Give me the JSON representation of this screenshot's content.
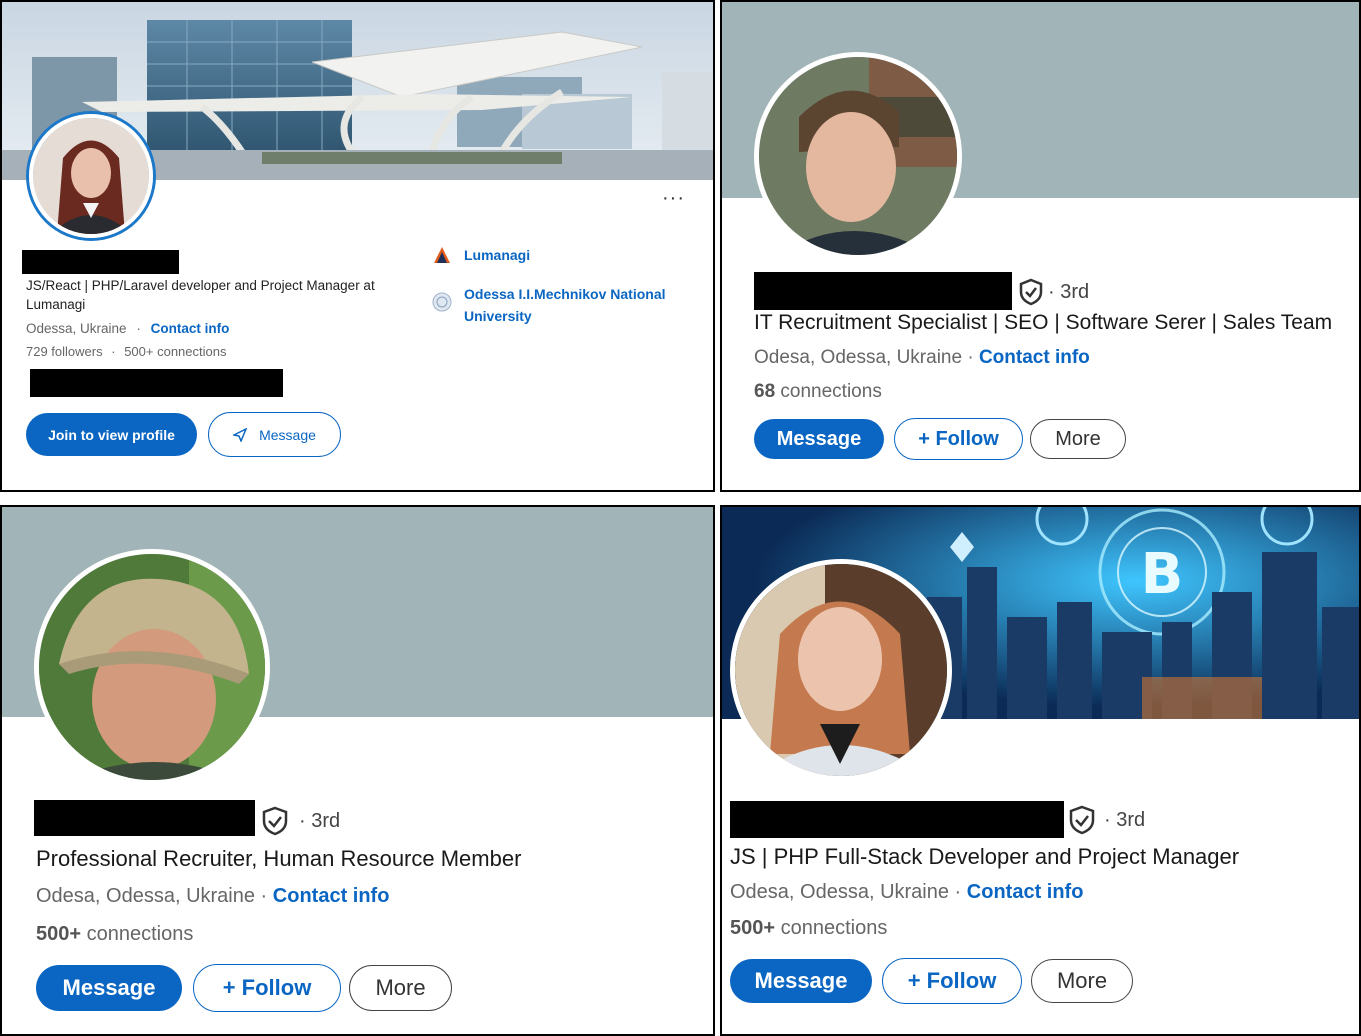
{
  "profiles": [
    {
      "headline_line1": "JS/React | PHP/Laravel developer and Project Manager at",
      "headline_line2": "Lumanagi",
      "location": "Odessa, Ukraine",
      "separator": "·",
      "contact_label": "Contact info",
      "followers": "729 followers",
      "connections": "500+ connections",
      "more_menu": "···",
      "company": "Lumanagi",
      "school_line1": "Odessa I.I.Mechnikov National",
      "school_line2": "University",
      "primary_button": "Join to view profile",
      "secondary_button": "Message"
    },
    {
      "degree": "· 3rd",
      "headline": "IT Recruitment Specialist | SEO | Software Serer | Sales Team",
      "location": "Odesa, Odessa, Ukraine ·",
      "contact_label": "Contact info",
      "connections_count": "68",
      "connections_label": " connections",
      "message_button": "Message",
      "follow_button": "+ Follow",
      "more_button": "More"
    },
    {
      "degree": "· 3rd",
      "headline": "Professional Recruiter, Human Resource Member",
      "location": "Odesa, Odessa, Ukraine ·",
      "contact_label": "Contact info",
      "connections_count": "500+",
      "connections_label": " connections",
      "message_button": "Message",
      "follow_button": "+ Follow",
      "more_button": "More"
    },
    {
      "degree": "· 3rd",
      "headline": "JS | PHP Full-Stack Developer and Project Manager",
      "location": "Odesa, Odessa, Ukraine ·",
      "contact_label": "Contact info",
      "connections_count": "500+",
      "connections_label": " connections",
      "message_button": "Message",
      "follow_button": "+ Follow",
      "more_button": "More"
    }
  ],
  "colors": {
    "linkedin_blue": "#0a66c2",
    "banner_gray": "#a1b4b7",
    "redaction": "#000000"
  }
}
